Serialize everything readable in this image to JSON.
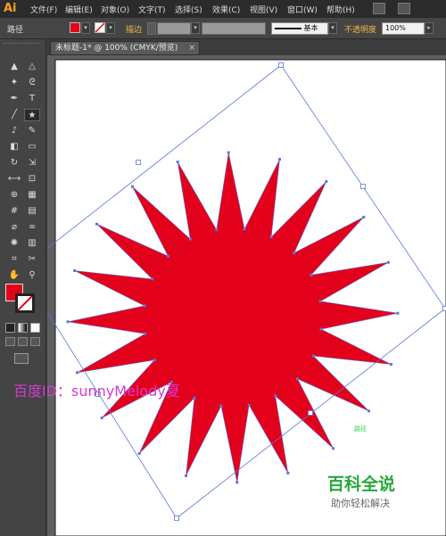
{
  "app": {
    "logo": "Ai"
  },
  "menu": [
    "文件(F)",
    "编辑(E)",
    "对象(O)",
    "文字(T)",
    "选择(S)",
    "效果(C)",
    "视图(V)",
    "窗口(W)",
    "帮助(H)"
  ],
  "control_bar": {
    "object_type": "路径",
    "fill_color": "#e3001b",
    "stroke_label": "描边",
    "stroke_profile": "基本",
    "opacity_label": "不透明度",
    "opacity_value": "100%"
  },
  "document_tab": {
    "title": "未标题-1* @ 100% (CMYK/预览)",
    "close": "×"
  },
  "toolbox": {
    "tools": [
      {
        "name": "selection-tool",
        "glyph": "▲"
      },
      {
        "name": "direct-selection-tool",
        "glyph": "△"
      },
      {
        "name": "magic-wand-tool",
        "glyph": "✦"
      },
      {
        "name": "lasso-tool",
        "glyph": "ᘓ"
      },
      {
        "name": "pen-tool",
        "glyph": "✒"
      },
      {
        "name": "type-tool",
        "glyph": "T"
      },
      {
        "name": "line-tool",
        "glyph": "╱"
      },
      {
        "name": "star-tool",
        "glyph": "★"
      },
      {
        "name": "paintbrush-tool",
        "glyph": "♪"
      },
      {
        "name": "pencil-tool",
        "glyph": "✎"
      },
      {
        "name": "blob-brush-tool",
        "glyph": "◧"
      },
      {
        "name": "eraser-tool",
        "glyph": "▭"
      },
      {
        "name": "rotate-tool",
        "glyph": "↻"
      },
      {
        "name": "scale-tool",
        "glyph": "⇲"
      },
      {
        "name": "width-tool",
        "glyph": "⟷"
      },
      {
        "name": "free-transform-tool",
        "glyph": "⊡"
      },
      {
        "name": "shape-builder-tool",
        "glyph": "⊕"
      },
      {
        "name": "perspective-grid-tool",
        "glyph": "▦"
      },
      {
        "name": "mesh-tool",
        "glyph": "#"
      },
      {
        "name": "gradient-tool",
        "glyph": "▤"
      },
      {
        "name": "eyedropper-tool",
        "glyph": "⌀"
      },
      {
        "name": "blend-tool",
        "glyph": "∞"
      },
      {
        "name": "symbol-sprayer-tool",
        "glyph": "✺"
      },
      {
        "name": "column-graph-tool",
        "glyph": "▥"
      },
      {
        "name": "artboard-tool",
        "glyph": "⌗"
      },
      {
        "name": "slice-tool",
        "glyph": "✂"
      },
      {
        "name": "hand-tool",
        "glyph": "✋"
      },
      {
        "name": "zoom-tool",
        "glyph": "⚲"
      }
    ],
    "fill_swatch_color": "#e3001b"
  },
  "canvas": {
    "shape_fill": "#e3001b",
    "selection_color": "#5a78d8",
    "smart_guide_label": "路径",
    "smart_guide_color": "#2fcf4a"
  },
  "watermark": "百度ID：sunnyMelody夏",
  "brand": {
    "title": "百科全说",
    "subtitle": "助你轻松解决"
  }
}
